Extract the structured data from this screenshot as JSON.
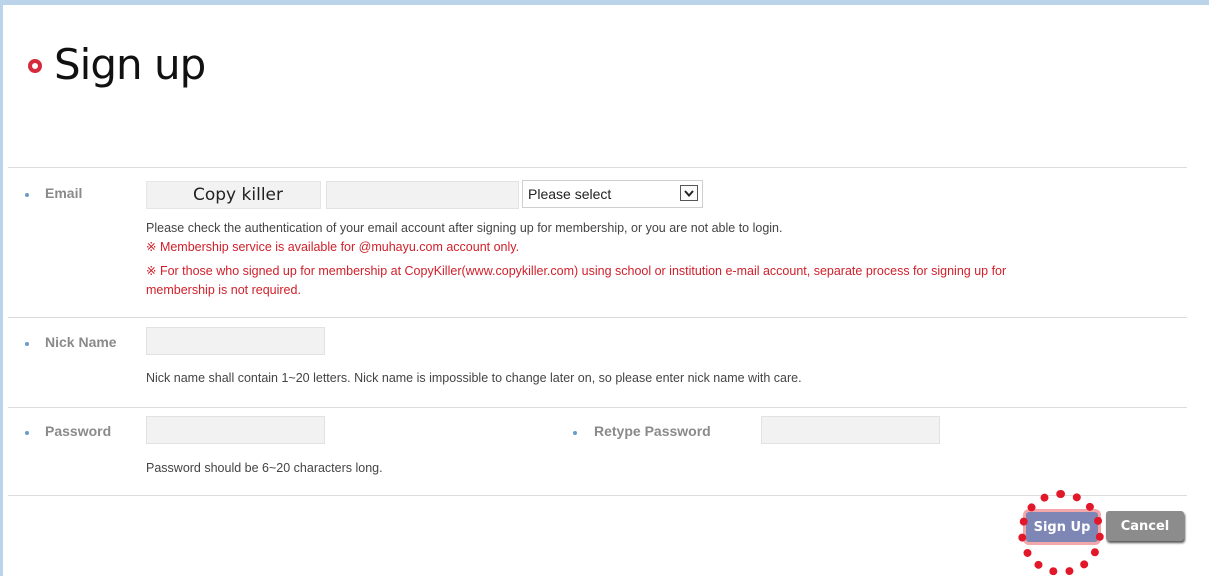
{
  "page": {
    "title": "Sign up"
  },
  "form": {
    "email": {
      "label": "Email",
      "local_value": "Copy killer",
      "at_symbol": "@",
      "domain_value": "",
      "domain_select_value": "Please select",
      "note": "Please check the authentication of your email account after signing up for membership, or you are not able to login.",
      "warning_1": "※ Membership service is available for @muhayu.com account only.",
      "warning_2_line1": "※ For those who signed up for membership at CopyKiller(www.copykiller.com) using school or institution e-mail account, separate process for signing up for",
      "warning_2_line2": "membership is not required."
    },
    "nickname": {
      "label": "Nick Name",
      "value": "",
      "note": "Nick name shall contain 1~20 letters. Nick name is impossible to change later on, so please enter nick name with care."
    },
    "password": {
      "label": "Password",
      "value": "",
      "retype_label": "Retype Password",
      "retype_value": "",
      "note": "Password should be 6~20 characters long."
    }
  },
  "actions": {
    "signup_label": "Sign Up",
    "cancel_label": "Cancel"
  },
  "colors": {
    "accent_red": "#d42c3c",
    "bullet_blue": "#6a9bc9",
    "signup_button": "#7e86b6",
    "cancel_button": "#8c8c8c",
    "highlight": "#e2182a"
  }
}
